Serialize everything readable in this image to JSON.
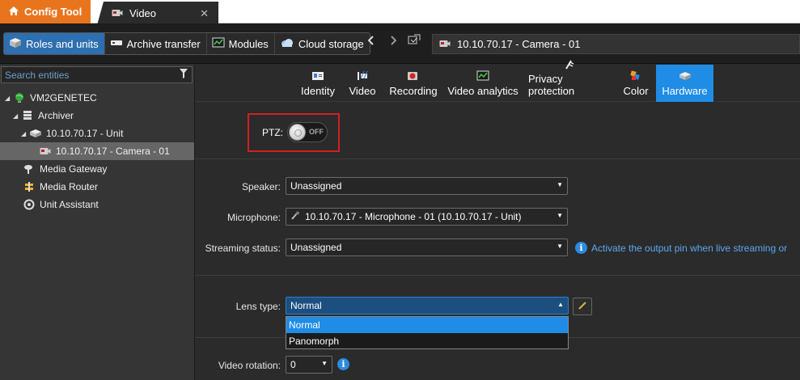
{
  "tabs": {
    "home": "Config Tool",
    "active": "Video",
    "close": "✕"
  },
  "toolbar": {
    "tasks": [
      {
        "label": "Roles and units",
        "icon": "roles-units-icon"
      },
      {
        "label": "Archive transfer",
        "icon": "archive-transfer-icon"
      },
      {
        "label": "Modules",
        "icon": "modules-icon"
      },
      {
        "label": "Cloud storage",
        "icon": "cloud-storage-icon"
      }
    ],
    "address": "10.10.70.17 - Camera - 01"
  },
  "search": {
    "placeholder": "Search entities"
  },
  "tree": [
    {
      "label": "VM2GENETEC",
      "icon": "server-globe-icon"
    },
    {
      "label": "Archiver",
      "icon": "archiver-icon"
    },
    {
      "label": "10.10.70.17 - Unit",
      "icon": "unit-icon"
    },
    {
      "label": "10.10.70.17 - Camera - 01",
      "icon": "camera-icon"
    },
    {
      "label": "Media Gateway",
      "icon": "media-gateway-icon"
    },
    {
      "label": "Media Router",
      "icon": "media-router-icon"
    },
    {
      "label": "Unit Assistant",
      "icon": "unit-assistant-icon"
    }
  ],
  "page_tabs": [
    {
      "label": "Identity",
      "icon": "identity-icon"
    },
    {
      "label": "Video",
      "icon": "video-icon"
    },
    {
      "label": "Recording",
      "icon": "recording-icon"
    },
    {
      "label": "Video analytics",
      "icon": "video-analytics-icon"
    },
    {
      "label": "Privacy protection",
      "icon": "privacy-protection-icon"
    },
    {
      "label": "Color",
      "icon": "color-icon"
    },
    {
      "label": "Hardware",
      "icon": "hardware-icon",
      "active": true
    }
  ],
  "ptz": {
    "label": "PTZ:",
    "state": "OFF"
  },
  "fields": {
    "speaker": {
      "label": "Speaker:",
      "value": "Unassigned"
    },
    "microphone": {
      "label": "Microphone:",
      "value": "10.10.70.17 - Microphone - 01 (10.10.70.17 - Unit)"
    },
    "streaming": {
      "label": "Streaming status:",
      "value": "Unassigned",
      "info": "Activate the output pin when live streaming or"
    },
    "lens": {
      "label": "Lens type:",
      "value": "Normal",
      "options": [
        "Normal",
        "Panomorph"
      ]
    },
    "rotation": {
      "label": "Video rotation:",
      "value": "0"
    }
  },
  "colors": {
    "accent": "#1f8ce6",
    "home_tab": "#e8751d",
    "highlight_box": "#d02020"
  }
}
